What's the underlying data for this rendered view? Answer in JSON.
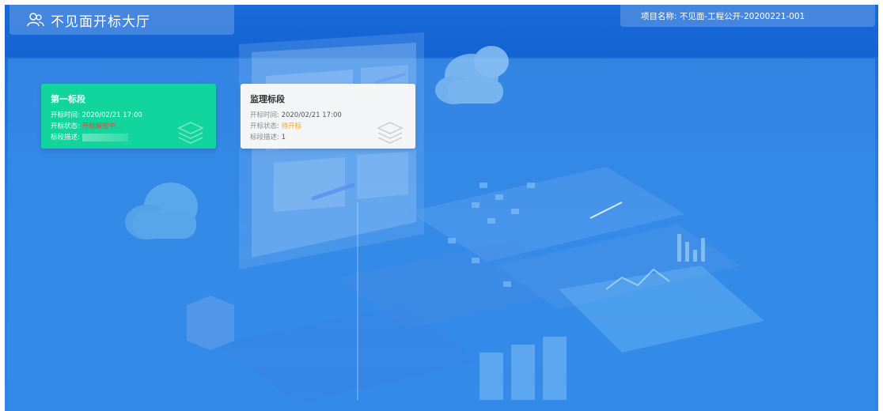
{
  "header": {
    "app_title": "不见面开标大厅",
    "project_label": "项目名称: 不见面-工程公开-20200221-001"
  },
  "cards": [
    {
      "title": "第一标段",
      "time_label": "开标时间: ",
      "time_value": "2020/02/21 17:00",
      "status_label": "开标状态: ",
      "status_value": "开标解密中...",
      "status_color": "#ff3b2f",
      "desc_label": "标段描述: ",
      "desc_value": "",
      "bg_color": "#11d59c",
      "icon": "layers-icon"
    },
    {
      "title": "监理标段",
      "time_label": "开标时间: ",
      "time_value": "2020/02/21 17:00",
      "status_label": "开标状态: ",
      "status_value": "待开标",
      "status_color": "#f5a623",
      "desc_label": "标段描述: ",
      "desc_value": "1",
      "bg_color": "#f4f5f6",
      "icon": "layers-icon"
    }
  ],
  "colors": {
    "background_top": "#1763cf",
    "background_bottom": "#2f88e9",
    "accent_green": "#11d59c"
  }
}
